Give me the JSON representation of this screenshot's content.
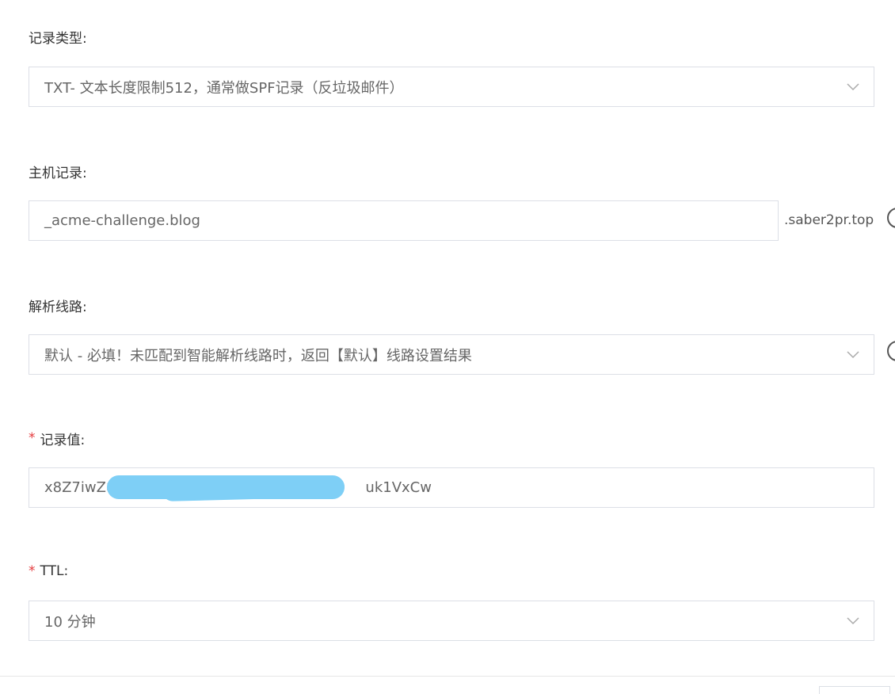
{
  "record_type": {
    "label": "记录类型:",
    "value": "TXT- 文本长度限制512，通常做SPF记录（反垃圾邮件）"
  },
  "host_record": {
    "label": "主机记录:",
    "value": "_acme-challenge.blog",
    "suffix": ".saber2pr.top"
  },
  "resolution_line": {
    "label": "解析线路:",
    "value": "默认 - 必填！未匹配到智能解析线路时，返回【默认】线路设置结果"
  },
  "record_value": {
    "label": "记录值:",
    "required_mark": "*",
    "value_start": "x8Z7iwZ8",
    "value_end": "uk1VxCw"
  },
  "ttl": {
    "label": "TTL:",
    "required_mark": "*",
    "value": "10 分钟"
  },
  "icons": {
    "select_arrow": "chevron-down-icon",
    "help": "help-circle-icon"
  },
  "colors": {
    "required": "#e4393c",
    "border": "#dcdfe6",
    "redaction": "#7ecff6"
  }
}
